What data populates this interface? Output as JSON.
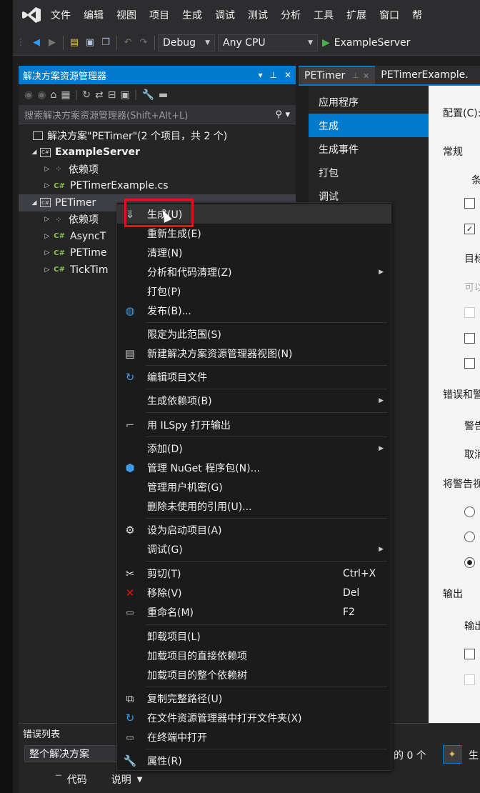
{
  "menubar": {
    "items": [
      "文件",
      "编辑",
      "视图",
      "项目",
      "生成",
      "调试",
      "测试",
      "分析",
      "工具",
      "扩展",
      "窗口",
      "帮"
    ]
  },
  "toolbar": {
    "config": "Debug",
    "platform": "Any CPU",
    "start": "ExampleServer"
  },
  "solution_explorer": {
    "title": "解决方案资源管理器",
    "search_placeholder": "搜索解决方案资源管理器(Shift+Alt+L)",
    "tree": [
      {
        "label": "解决方案\"PETimer\"(2 个项目，共 2 个)"
      },
      {
        "label": "ExampleServer"
      },
      {
        "label": "依赖项"
      },
      {
        "label": "PETimerExample.cs"
      },
      {
        "label": "PETimer"
      },
      {
        "label": "依赖项"
      },
      {
        "label": "AsyncT"
      },
      {
        "label": "PETime"
      },
      {
        "label": "TickTim"
      }
    ]
  },
  "tabs": [
    {
      "label": "PETimer"
    },
    {
      "label": "PETimerExample."
    }
  ],
  "prop_nav": {
    "items": [
      "应用程序",
      "生成",
      "生成事件",
      "打包",
      "调试"
    ]
  },
  "prop_page": {
    "config_label": "配置(C):",
    "section_general": "常规",
    "cond": "条",
    "target": "目标",
    "allow": "可以",
    "errors": "错误和警",
    "warning": "警告",
    "suppress": "取消",
    "treat_warnings": "将警告视",
    "output": "输出",
    "output_path": "输出"
  },
  "context_menu": {
    "items": [
      {
        "label": "生成(U)"
      },
      {
        "label": "重新生成(E)"
      },
      {
        "label": "清理(N)"
      },
      {
        "label": "分析和代码清理(Z)"
      },
      {
        "label": "打包(P)"
      },
      {
        "label": "发布(B)..."
      },
      {
        "label": "限定为此范围(S)"
      },
      {
        "label": "新建解决方案资源管理器视图(N)"
      },
      {
        "label": "编辑项目文件"
      },
      {
        "label": "生成依赖项(B)"
      },
      {
        "label": "用 ILSpy 打开输出"
      },
      {
        "label": "添加(D)"
      },
      {
        "label": "管理 NuGet 程序包(N)..."
      },
      {
        "label": "管理用户机密(G)"
      },
      {
        "label": "删除未使用的引用(U)..."
      },
      {
        "label": "设为启动项目(A)"
      },
      {
        "label": "调试(G)"
      },
      {
        "label": "剪切(T)",
        "shortcut": "Ctrl+X"
      },
      {
        "label": "移除(V)",
        "shortcut": "Del"
      },
      {
        "label": "重命名(M)",
        "shortcut": "F2"
      },
      {
        "label": "卸载项目(L)"
      },
      {
        "label": "加载项目的直接依赖项"
      },
      {
        "label": "加载项目的整个依赖树"
      },
      {
        "label": "复制完整路径(U)"
      },
      {
        "label": "在文件资源管理器中打开文件夹(X)"
      },
      {
        "label": "在终端中打开"
      },
      {
        "label": "属性(R)"
      }
    ]
  },
  "error_list": {
    "title": "错误列表",
    "scope": "整个解决方案",
    "count_text": "的 0 个",
    "more": "生",
    "col_code": "代码",
    "col_desc": "说明"
  }
}
